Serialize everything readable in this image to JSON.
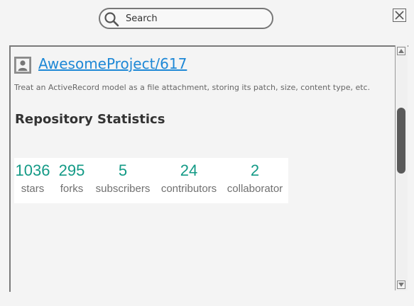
{
  "search": {
    "placeholder": "Search",
    "value": ""
  },
  "repo": {
    "name": "AwesomeProject/617",
    "description": "Treat an ActiveRecord model as a file attachment, storing its patch, size, content type, etc."
  },
  "statistics": {
    "title": "Repository Statistics",
    "items": [
      {
        "value": "1036",
        "label": "stars"
      },
      {
        "value": "295",
        "label": "forks"
      },
      {
        "value": "5",
        "label": "subscribers"
      },
      {
        "value": "24",
        "label": "contributors"
      },
      {
        "value": "2",
        "label": "collaborator"
      }
    ]
  },
  "colors": {
    "link": "#1e88d6",
    "stat_value": "#139a86",
    "stat_label": "#707070"
  },
  "scroll_position": 0.33
}
